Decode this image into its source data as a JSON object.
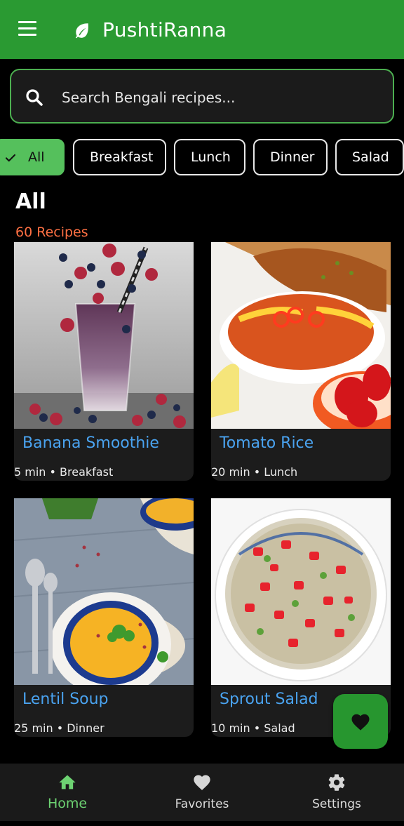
{
  "app": {
    "title": "PushtiRanna"
  },
  "colors": {
    "primary": "#2a9a32",
    "accent": "#55c05c",
    "count": "#ff7043",
    "recipe_name": "#4aa3f0"
  },
  "search": {
    "placeholder": "Search Bengali recipes..."
  },
  "filters": [
    {
      "label": "All",
      "selected": true
    },
    {
      "label": "Breakfast",
      "selected": false
    },
    {
      "label": "Lunch",
      "selected": false
    },
    {
      "label": "Dinner",
      "selected": false
    },
    {
      "label": "Salad",
      "selected": false
    }
  ],
  "section": {
    "title": "All",
    "count": "60 Recipes"
  },
  "recipes": [
    {
      "name": "Banana Smoothie",
      "meta": "5 min • Breakfast",
      "image": "berry-smoothie-photo"
    },
    {
      "name": "Tomato Rice",
      "meta": "20 min • Lunch",
      "image": "tomato-rice-photo"
    },
    {
      "name": "Lentil Soup",
      "meta": "25 min • Dinner",
      "image": "lentil-soup-photo"
    },
    {
      "name": "Sprout Salad",
      "meta": "10 min • Salad",
      "image": "sprout-salad-photo"
    }
  ],
  "fab": {
    "icon": "heart-icon"
  },
  "bottom_nav": [
    {
      "label": "Home",
      "icon": "home-icon",
      "active": true
    },
    {
      "label": "Favorites",
      "icon": "heart-icon",
      "active": false
    },
    {
      "label": "Settings",
      "icon": "gear-icon",
      "active": false
    }
  ]
}
